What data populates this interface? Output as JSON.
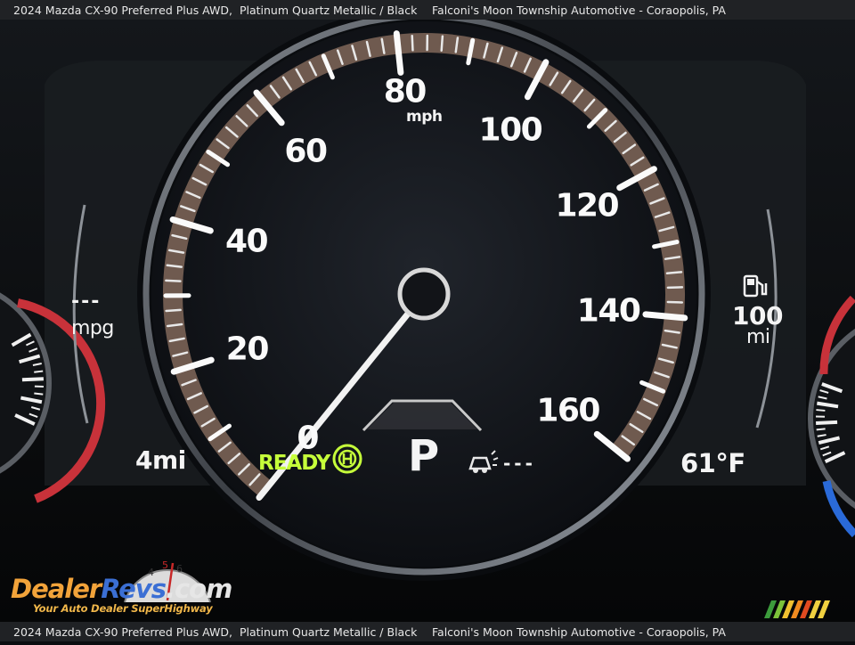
{
  "caption": {
    "vehicle": "2024 Mazda CX-90 Preferred Plus AWD,",
    "color": "Platinum Quartz Metallic / Black",
    "dealer": "Falconi's Moon Township Automotive - Coraopolis, PA"
  },
  "speedometer": {
    "unit": "mph",
    "major_labels": [
      "0",
      "20",
      "40",
      "60",
      "80",
      "100",
      "120",
      "140",
      "160"
    ],
    "current_speed_mph": 0,
    "max_speed_mph": 160
  },
  "left_panel": {
    "fuel_economy_value": "---",
    "fuel_economy_unit": "mpg",
    "trip_distance": "4mi"
  },
  "right_panel": {
    "range_value": "100",
    "range_unit": "mi",
    "fuel_pump_icon": "fuel-pump-icon",
    "outside_temp": "61°F"
  },
  "status": {
    "ready_text": "READY",
    "ready_color": "#c6ff3a",
    "brake_hold_icon": "brake-hold-icon",
    "gear": "P",
    "cruise_icon": "radar-cruise-icon",
    "cruise_set_speed": "---"
  },
  "watermark": {
    "brand_1": "Dealer",
    "brand_2": "Revs",
    "brand_3": ".com",
    "tagline": "Your Auto Dealer SuperHighway",
    "brand_orange": "#f2a33a",
    "brand_blue": "#3b6fd4"
  }
}
